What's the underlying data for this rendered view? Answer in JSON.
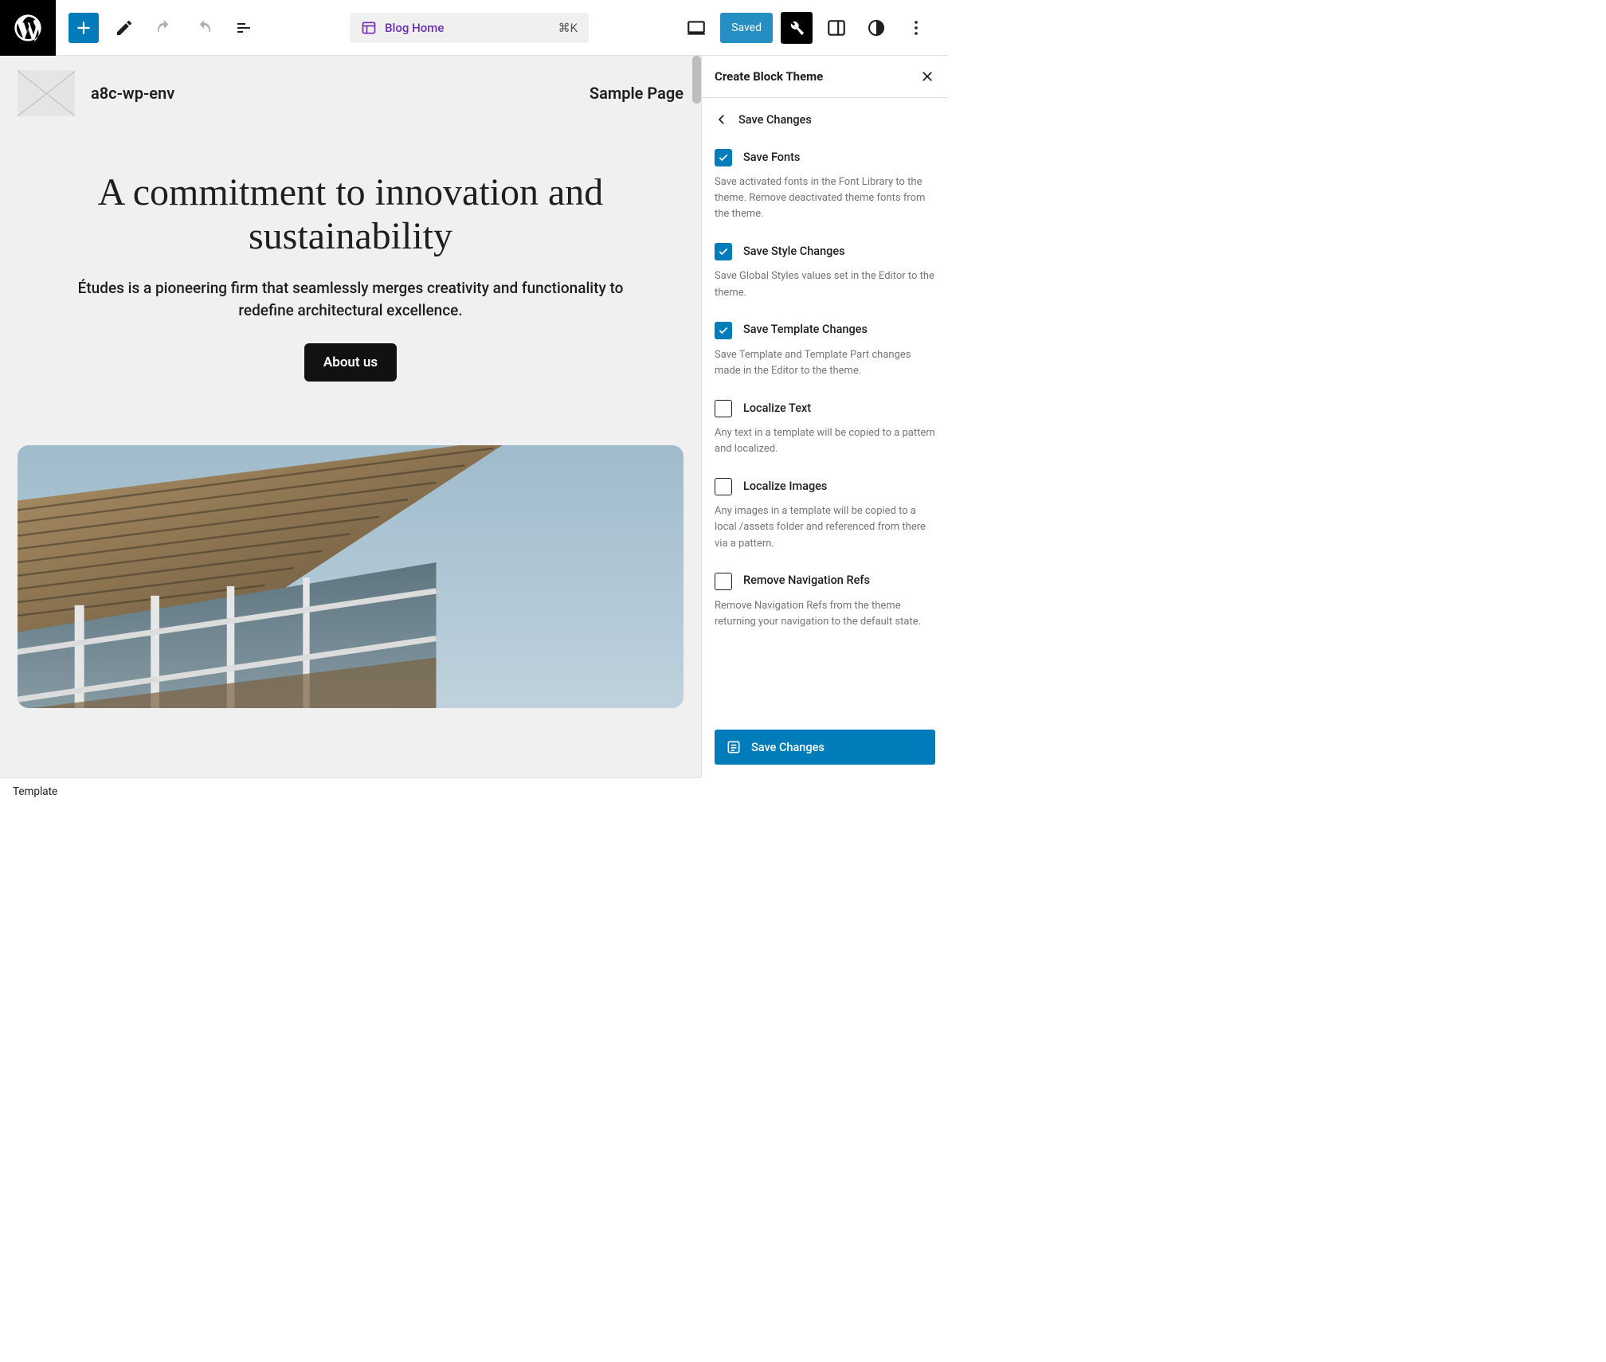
{
  "toolbar": {
    "document_title": "Blog Home",
    "shortcut": "⌘K",
    "saved_label": "Saved"
  },
  "site": {
    "title": "a8c-wp-env",
    "nav_item": "Sample Page"
  },
  "hero": {
    "heading": "A commitment to innovation and sustainability",
    "subheading": "Études is a pioneering firm that seamlessly merges creativity and functionality to redefine architectural excellence.",
    "cta_label": "About us"
  },
  "panel": {
    "title": "Create Block Theme",
    "nav_back_label": "Save Changes",
    "options": [
      {
        "label": "Save Fonts",
        "desc": "Save activated fonts in the Font Library to the theme. Remove deactivated theme fonts from the theme.",
        "checked": true
      },
      {
        "label": "Save Style Changes",
        "desc": "Save Global Styles values set in the Editor to the theme.",
        "checked": true
      },
      {
        "label": "Save Template Changes",
        "desc": "Save Template and Template Part changes made in the Editor to the theme.",
        "checked": true
      },
      {
        "label": "Localize Text",
        "desc": "Any text in a template will be copied to a pattern and localized.",
        "checked": false
      },
      {
        "label": "Localize Images",
        "desc": "Any images in a template will be copied to a local /assets folder and referenced from there via a pattern.",
        "checked": false
      },
      {
        "label": "Remove Navigation Refs",
        "desc": "Remove Navigation Refs from the theme returning your navigation to the default state.",
        "checked": false
      }
    ],
    "save_button_label": "Save Changes"
  },
  "status_bar": {
    "breadcrumb": "Template"
  }
}
